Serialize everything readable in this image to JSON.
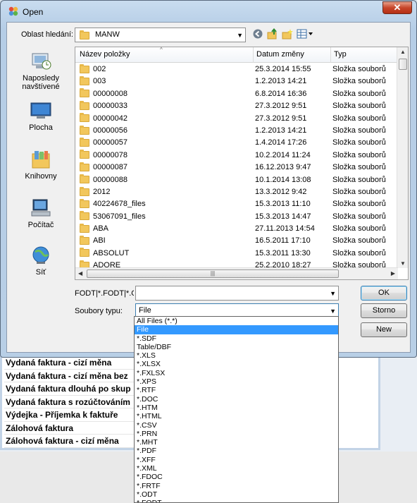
{
  "background": {
    "rows": [
      "Vydaná faktura - cizí měna",
      "Vydaná faktura - cizí měna bez",
      "Vydaná faktura dlouhá po skup",
      "Vydaná faktura s rozúčtováním",
      "Výdejka - Příjemka k faktuře",
      "Zálohová faktura",
      "Zálohová faktura - cizí měna"
    ]
  },
  "dialog": {
    "title": "Open",
    "close_label": "✕",
    "look_in_label": "Oblast hledání:",
    "look_in_value": "MANW",
    "nav": [
      {
        "label": "Naposledy navštívené",
        "icon": "recent-places-icon"
      },
      {
        "label": "Plocha",
        "icon": "desktop-icon"
      },
      {
        "label": "Knihovny",
        "icon": "libraries-icon"
      },
      {
        "label": "Počítač",
        "icon": "computer-icon"
      },
      {
        "label": "Síť",
        "icon": "network-icon"
      }
    ],
    "columns": {
      "name": "Název položky",
      "date": "Datum změny",
      "type": "Typ"
    },
    "files": [
      {
        "name": "002",
        "date": "25.3.2014 15:55",
        "type": "Složka souborů"
      },
      {
        "name": "003",
        "date": "1.2.2013 14:21",
        "type": "Složka souborů"
      },
      {
        "name": "00000008",
        "date": "6.8.2014 16:36",
        "type": "Složka souborů"
      },
      {
        "name": "00000033",
        "date": "27.3.2012 9:51",
        "type": "Složka souborů"
      },
      {
        "name": "00000042",
        "date": "27.3.2012 9:51",
        "type": "Složka souborů"
      },
      {
        "name": "00000056",
        "date": "1.2.2013 14:21",
        "type": "Složka souborů"
      },
      {
        "name": "00000057",
        "date": "1.4.2014 17:26",
        "type": "Složka souborů"
      },
      {
        "name": "00000078",
        "date": "10.2.2014 11:24",
        "type": "Složka souborů"
      },
      {
        "name": "00000087",
        "date": "16.12.2013 9:47",
        "type": "Složka souborů"
      },
      {
        "name": "00000088",
        "date": "10.1.2014 13:08",
        "type": "Složka souborů"
      },
      {
        "name": "2012",
        "date": "13.3.2012 9:42",
        "type": "Složka souborů"
      },
      {
        "name": "40224678_files",
        "date": "15.3.2013 11:10",
        "type": "Složka souborů"
      },
      {
        "name": "53067091_files",
        "date": "15.3.2013 14:47",
        "type": "Složka souborů"
      },
      {
        "name": "ABA",
        "date": "27.11.2013 14:54",
        "type": "Složka souborů"
      },
      {
        "name": "ABI",
        "date": "16.5.2011 17:10",
        "type": "Složka souborů"
      },
      {
        "name": "ABSOLUT",
        "date": "15.3.2011 13:30",
        "type": "Složka souborů"
      },
      {
        "name": "ADORE",
        "date": "25.2.2010 18:27",
        "type": "Složka souborů"
      }
    ],
    "filename_label": "FODT|*.FODT|*.OI",
    "filename_value": "",
    "filetype_label": "Soubory typu:",
    "filetype_value": "File",
    "buttons": {
      "ok": "OK",
      "cancel": "Storno",
      "new": "New"
    },
    "filetype_options": [
      "All Files (*.*)",
      "File",
      "*.SDF",
      "Table/DBF",
      "*.XLS",
      "*.XLSX",
      "*.FXLSX",
      "*.XPS",
      "*.RTF",
      "*.DOC",
      "*.HTM",
      "*.HTML",
      "*.CSV",
      "*.PRN",
      "*.MHT",
      "*.PDF",
      "*.XFF",
      "*.XML",
      "*.FDOC",
      "*.FRTF",
      "*.ODT",
      "*.FODT"
    ],
    "selected_option_index": 1
  }
}
